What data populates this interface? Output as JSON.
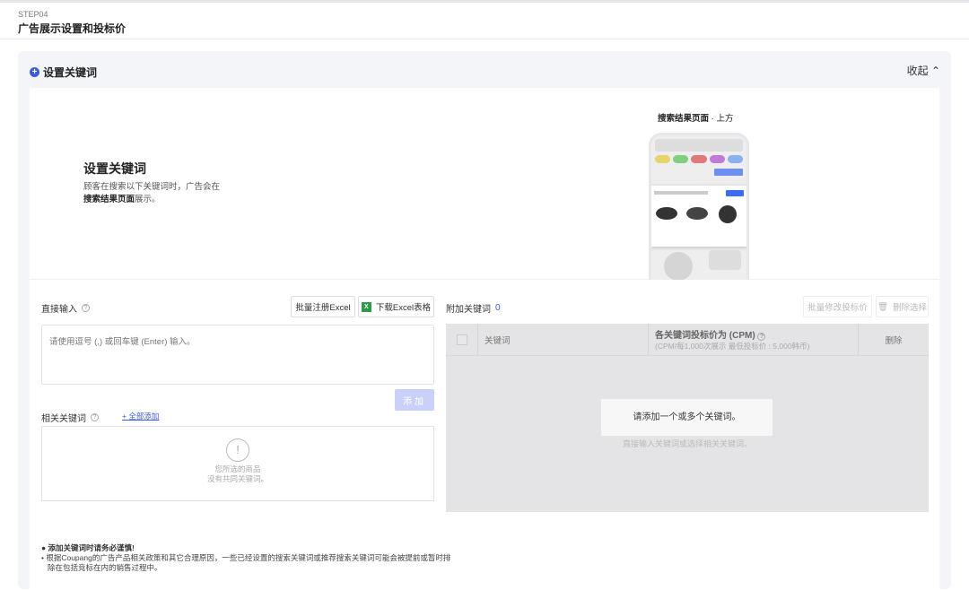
{
  "header": {
    "step": "STEP04",
    "title": "广告展示设置和投标价"
  },
  "panel": {
    "title": "设置关键词",
    "collapse": "收起 ⌃"
  },
  "illustration": {
    "title": "设置关键词",
    "desc_1": "顾客在搜索以下关键词时，广告会在",
    "desc_bold": "搜索结果页面",
    "desc_2": "展示。",
    "preview_label_bold": "搜索结果页面",
    "preview_label": " · 上方"
  },
  "direct": {
    "label": "直接输入",
    "bulk_excel": "批量注册Excel",
    "download_excel": "下载Excel表格",
    "placeholder": "请使用逗号 (,) 或回车键 (Enter) 输入。",
    "add": "添加"
  },
  "related": {
    "label": "相关关键词",
    "add_all": "全部添加",
    "empty_1": "您所选的商品",
    "empty_2": "没有共同关键词。"
  },
  "added": {
    "label": "附加关键词",
    "count": "0",
    "bulk_bid": "批量修改投标价",
    "delete_selected": "删除选择",
    "columns": {
      "keyword": "关键词",
      "bid": "各关键词投标价为 (CPM)",
      "bid_sub": "(CPM/每1,000次展示 最低投标价 : 5,000韩币)",
      "delete": "删除"
    },
    "empty": "请添加一个或多个关键词。",
    "empty_sub": "直接输入关键词或选择相关关键词。"
  },
  "notice": {
    "title": "添加关键词时请务必谨慎!",
    "line1": "• 根据Coupang的广告产品相关政策和其它合理原因，一些已经设置的搜索关键词或推荐搜索关键词可能会被提前或暂时排",
    "line2": "除在包括竞标在内的销售过程中。"
  }
}
